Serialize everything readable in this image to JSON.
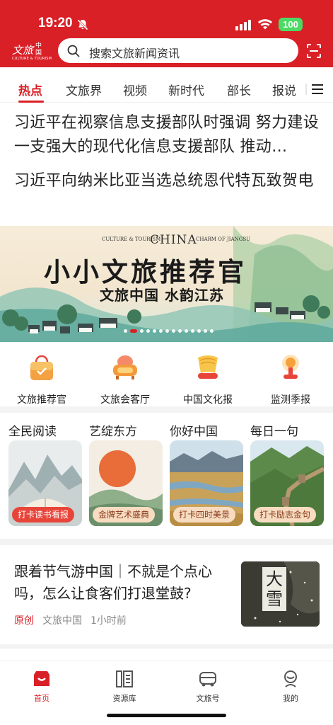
{
  "status_bar": {
    "time": "19:20",
    "battery": "100"
  },
  "header": {
    "logo_main": "文旅",
    "logo_side": "中国",
    "logo_sub": "CULTURE & TOURISM",
    "search_placeholder": "搜索文旅新闻资讯"
  },
  "tabs": [
    {
      "label": "热点",
      "active": true
    },
    {
      "label": "文旅界",
      "active": false
    },
    {
      "label": "视频",
      "active": false
    },
    {
      "label": "新时代",
      "active": false
    },
    {
      "label": "部长",
      "active": false
    },
    {
      "label": "报说",
      "active": false
    }
  ],
  "headlines": [
    "习近平在视察信息支援部队时强调 努力建设一支强大的现代化信息支援部队 推动…",
    "习近平向纳米比亚当选总统恩代特瓦致贺电"
  ],
  "banner": {
    "tag_left": "CULTURE & TOURISM",
    "china": "CHINA",
    "tag_right": "CHARM OF JIANGSU",
    "title": "小小文旅推荐官",
    "subtitle": "文旅中国 水韵江苏",
    "dot_count": 14,
    "active_dot": 1
  },
  "quick_links": [
    {
      "label": "文旅推荐官",
      "icon": "shopping-bag-icon"
    },
    {
      "label": "文旅会客厅",
      "icon": "sofa-icon"
    },
    {
      "label": "中国文化报",
      "icon": "newspaper-scroll-icon"
    },
    {
      "label": "监测季报",
      "icon": "lamp-report-icon"
    }
  ],
  "activities": [
    {
      "title": "全民阅读",
      "pill": "打卡读书看报"
    },
    {
      "title": "艺绽东方",
      "pill": "金牌艺术盛典"
    },
    {
      "title": "你好中国",
      "pill": "打卡四时美景"
    },
    {
      "title": "每日一句",
      "pill": "打卡励志金句"
    }
  ],
  "article": {
    "title": "跟着节气游中国｜不就是个点心吗，怎么让食客们打退堂鼓?",
    "tag": "原创",
    "source": "文旅中国",
    "time": "1小时前",
    "thumb_text": "大雪"
  },
  "bottom_nav": [
    {
      "label": "首页",
      "active": true,
      "icon": "home-icon"
    },
    {
      "label": "资源库",
      "active": false,
      "icon": "library-icon"
    },
    {
      "label": "文旅号",
      "active": false,
      "icon": "bus-icon"
    },
    {
      "label": "我的",
      "active": false,
      "icon": "profile-icon"
    }
  ],
  "colors": {
    "brand": "#d92027",
    "pill_red": "#e8453a",
    "pill_cream": "#f7dcc1"
  }
}
